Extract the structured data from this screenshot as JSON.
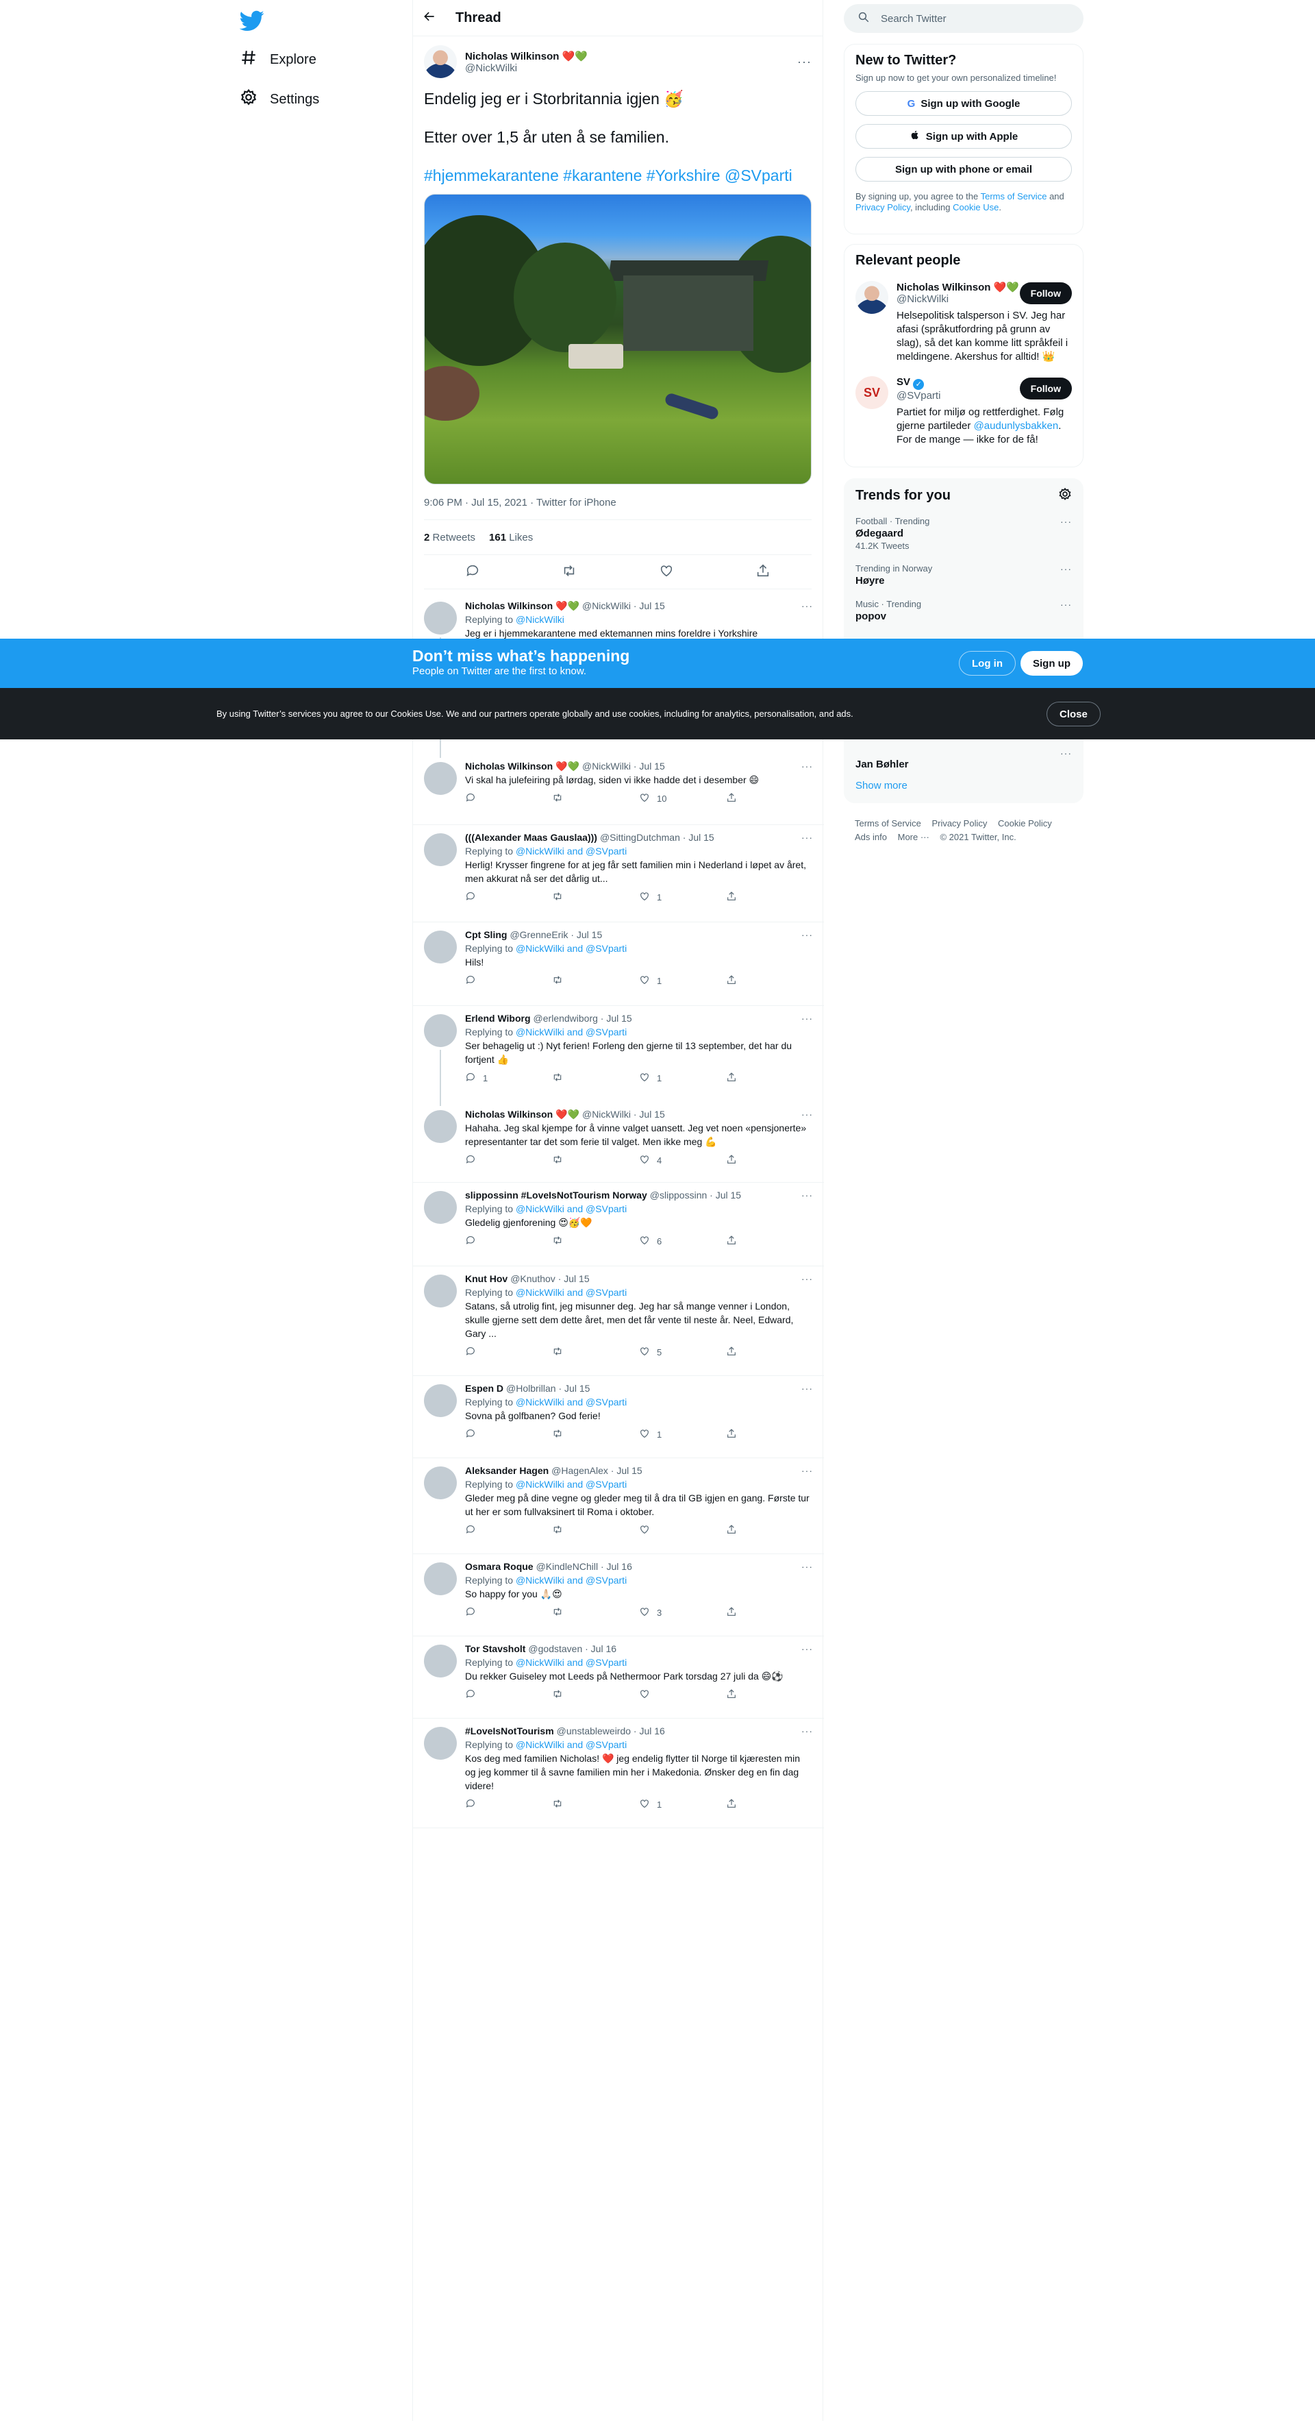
{
  "nav": {
    "explore": "Explore",
    "settings": "Settings"
  },
  "header": {
    "title": "Thread"
  },
  "main_tweet": {
    "name": "Nicholas Wilkinson ❤️💚",
    "handle": "@NickWilki",
    "line1": "Endelig jeg er i Storbritannia igjen 🥳",
    "line2": "Etter over 1,5 år uten å se familien.",
    "hashtags": "#hjemmekarantene #karantene #Yorkshire @SVparti",
    "meta": "9:06 PM · Jul 15, 2021 · Twitter for iPhone",
    "retweets": "2",
    "retweets_label": "Retweets",
    "likes": "161",
    "likes_label": "Likes"
  },
  "replies": [
    {
      "name": "Nicholas Wilkinson ❤️💚",
      "meta": "@NickWilki · Jul 15",
      "replying": "@NickWilki",
      "text": "Jeg er i hjemmekarantene med ektemannen mins foreldre i Yorkshire",
      "replies": "",
      "likes": ""
    },
    {
      "name": "Nicholas Wilkinson ❤️💚",
      "meta": "@NickWilki · Jul 15",
      "replying": "",
      "text": "Vi skal ha julefeiring på lørdag, siden vi ikke hadde det i desember 😄",
      "replies": "",
      "likes": "10"
    },
    {
      "name": "(((Alexander Maas Gauslaa)))",
      "meta": "@SittingDutchman · Jul 15",
      "replying": "@NickWilki and @SVparti",
      "text": "Herlig! Krysser fingrene for at jeg får sett familien min i Nederland i løpet av året, men akkurat nå ser det dårlig ut...",
      "replies": "",
      "likes": "1"
    },
    {
      "name": "Cpt Sling",
      "meta": "@GrenneErik · Jul 15",
      "replying": "@NickWilki and @SVparti",
      "text": "Hils!",
      "replies": "",
      "likes": "1"
    },
    {
      "name": "Erlend Wiborg",
      "meta": "@erlendwiborg · Jul 15",
      "replying": "@NickWilki and @SVparti",
      "text": "Ser behagelig ut :) Nyt ferien! Forleng den gjerne til 13 september, det har du fortjent 👍",
      "replies": "1",
      "likes": "1"
    },
    {
      "name": "Nicholas Wilkinson ❤️💚",
      "meta": "@NickWilki · Jul 15",
      "replying": "",
      "text": "Hahaha. Jeg skal kjempe for å vinne valget uansett. Jeg vet noen «pensjonerte» representanter tar det som ferie til valget. Men ikke meg 💪",
      "replies": "",
      "likes": "4"
    },
    {
      "name": "slippossinn #LoveIsNotTourism Norway",
      "meta": "@slippossinn · Jul 15",
      "replying": "@NickWilki and @SVparti",
      "text": "Gledelig gjenforening 😍🥳🧡",
      "replies": "",
      "likes": "6"
    },
    {
      "name": "Knut Hov",
      "meta": "@Knuthov · Jul 15",
      "replying": "@NickWilki and @SVparti",
      "text": "Satans, så utrolig fint, jeg misunner deg. Jeg har så mange venner i London, skulle gjerne sett dem dette året, men det får vente til neste år. Neel, Edward, Gary ...",
      "replies": "",
      "likes": "5"
    },
    {
      "name": "Espen D",
      "meta": "@Holbrillan · Jul 15",
      "replying": "@NickWilki and @SVparti",
      "text": "Sovna på golfbanen? God ferie!",
      "replies": "",
      "likes": "1"
    },
    {
      "name": "Aleksander Hagen",
      "meta": "@HagenAlex · Jul 15",
      "replying": "@NickWilki and @SVparti",
      "text": "Gleder meg på dine vegne og gleder meg til å dra til GB igjen en gang. Første tur ut her er som fullvaksinert til Roma i oktober.",
      "replies": "",
      "likes": ""
    },
    {
      "name": "Osmara Roque",
      "meta": "@KindleNChill · Jul 16",
      "replying": "@NickWilki and @SVparti",
      "text": "So happy for you 🙏🏻😍",
      "replies": "",
      "likes": "3"
    },
    {
      "name": "Tor Stavsholt",
      "meta": "@godstaven · Jul 16",
      "replying": "@NickWilki and @SVparti",
      "text": "Du rekker Guiseley mot Leeds  på Nethermoor Park torsdag 27 juli da 😄⚽",
      "replies": "",
      "likes": ""
    },
    {
      "name": "#LoveIsNotTourism",
      "meta": "@unstableweirdo · Jul 16",
      "replying": "@NickWilki and @SVparti",
      "text": "Kos deg med familien Nicholas! ❤️ jeg endelig flytter til Norge til kjæresten min og jeg kommer til å savne familien min her i Makedonia. Ønsker deg en fin dag videre!",
      "replies": "",
      "likes": "1"
    }
  ],
  "replying_prefix": "Replying to",
  "search": {
    "placeholder": "Search Twitter"
  },
  "new_to_twitter": {
    "title": "New to Twitter?",
    "subtitle": "Sign up now to get your own personalized timeline!",
    "google": "Sign up with Google",
    "apple": "Sign up with Apple",
    "phone": "Sign up with phone or email",
    "legal_1": "By signing up, you agree to the",
    "tos": "Terms of Service",
    "and": "and",
    "privacy": "Privacy Policy",
    "including": ", including",
    "cookie": "Cookie Use",
    "legal_end": "."
  },
  "relevant": {
    "title": "Relevant people",
    "people": [
      {
        "name": "Nicholas Wilkinson ❤️💚",
        "handle": "@NickWilki",
        "bio": "Helsepolitisk talsperson i SV. Jeg har afasi (språkutfordring på grunn av slag), så det kan komme litt språkfeil i meldingene. Akershus for alltid! 👑",
        "button": "Follow"
      },
      {
        "name": "SV",
        "handle": "@SVparti",
        "bio": "Partiet for miljø og rettferdighet. Følg gjerne partileder",
        "bio_link": "@audunlysbakken",
        "bio_end": ". For de mange — ikke for de få!",
        "button": "Follow"
      }
    ]
  },
  "trends": {
    "title": "Trends for you",
    "items": [
      {
        "category": "Football · Trending",
        "name": "Ødegaard",
        "count": "41.2K Tweets"
      },
      {
        "category": "Trending in Norway",
        "name": "Høyre",
        "count": ""
      },
      {
        "category": "Music · Trending",
        "name": "popov",
        "count": ""
      },
      {
        "category": "",
        "name": "Jan Bøhler",
        "count": ""
      }
    ],
    "show_more": "Show more"
  },
  "footer": {
    "tos": "Terms of Service",
    "privacy": "Privacy Policy",
    "cookie": "Cookie Policy",
    "ads": "Ads info",
    "more": "More ···",
    "copyright": "© 2021 Twitter, Inc."
  },
  "banner": {
    "title": "Don’t miss what’s happening",
    "subtitle": "People on Twitter are the first to know.",
    "login": "Log in",
    "signup": "Sign up"
  },
  "cookie_bar": {
    "text": "By using Twitter’s services you agree to our Cookies Use. We and our partners operate globally and use cookies, including for analytics, personalisation, and ads.",
    "close": "Close"
  },
  "colors": {
    "accent": "#1d9bf0",
    "text": "#0f1419",
    "muted": "#536471",
    "cookie_bg": "#1b1f23"
  }
}
